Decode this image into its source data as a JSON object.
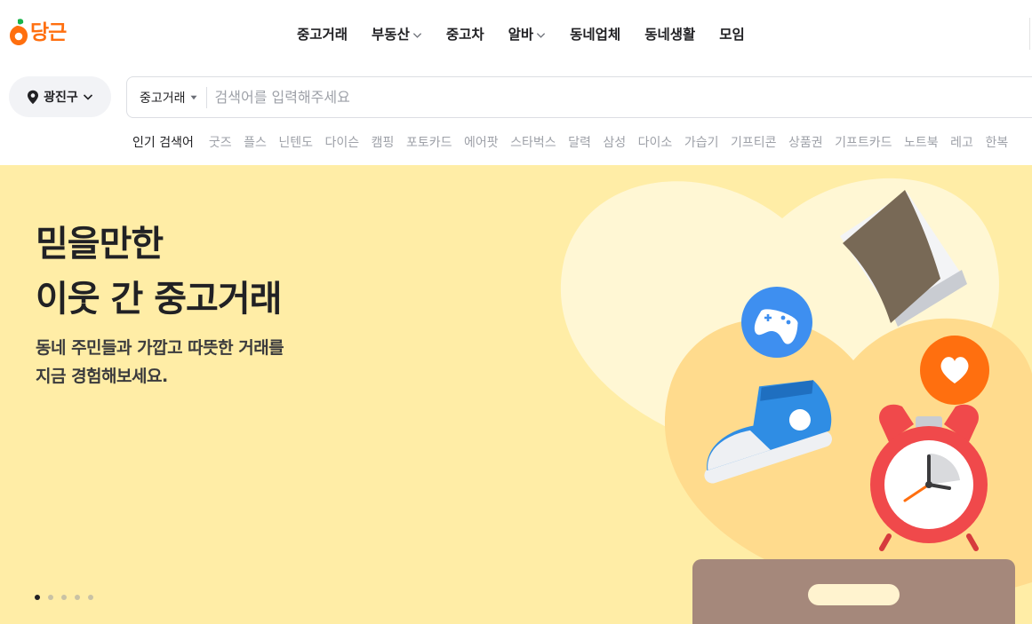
{
  "header": {
    "logo_text": "당근",
    "nav": [
      {
        "label": "중고거래",
        "dropdown": false
      },
      {
        "label": "부동산",
        "dropdown": true
      },
      {
        "label": "중고차",
        "dropdown": false
      },
      {
        "label": "알바",
        "dropdown": true
      },
      {
        "label": "동네업체",
        "dropdown": false
      },
      {
        "label": "동네생활",
        "dropdown": false
      },
      {
        "label": "모임",
        "dropdown": false
      }
    ]
  },
  "location": {
    "label": "광진구",
    "icon": "map-pin-icon"
  },
  "search": {
    "category": "중고거래",
    "placeholder": "검색어를 입력해주세요"
  },
  "popular": {
    "title": "인기 검색어",
    "keywords": [
      "굿즈",
      "플스",
      "닌텐도",
      "다이슨",
      "캠핑",
      "포토카드",
      "에어팟",
      "스타벅스",
      "달력",
      "삼성",
      "다이소",
      "가습기",
      "기프티콘",
      "상품권",
      "기프트카드",
      "노트북",
      "레고",
      "한복"
    ]
  },
  "hero": {
    "title_line1": "믿을만한",
    "title_line2": "이웃 간 중고거래",
    "subtitle_line1": "동네 주민들과 가깝고 따뜻한 거래를",
    "subtitle_line2": "지금 경험해보세요.",
    "slide_count": 5,
    "active_slide": 1
  },
  "colors": {
    "brand": "#ff6f0f",
    "hero_bg": "#ffeda6",
    "text": "#212124",
    "muted": "#9ea1a8"
  }
}
